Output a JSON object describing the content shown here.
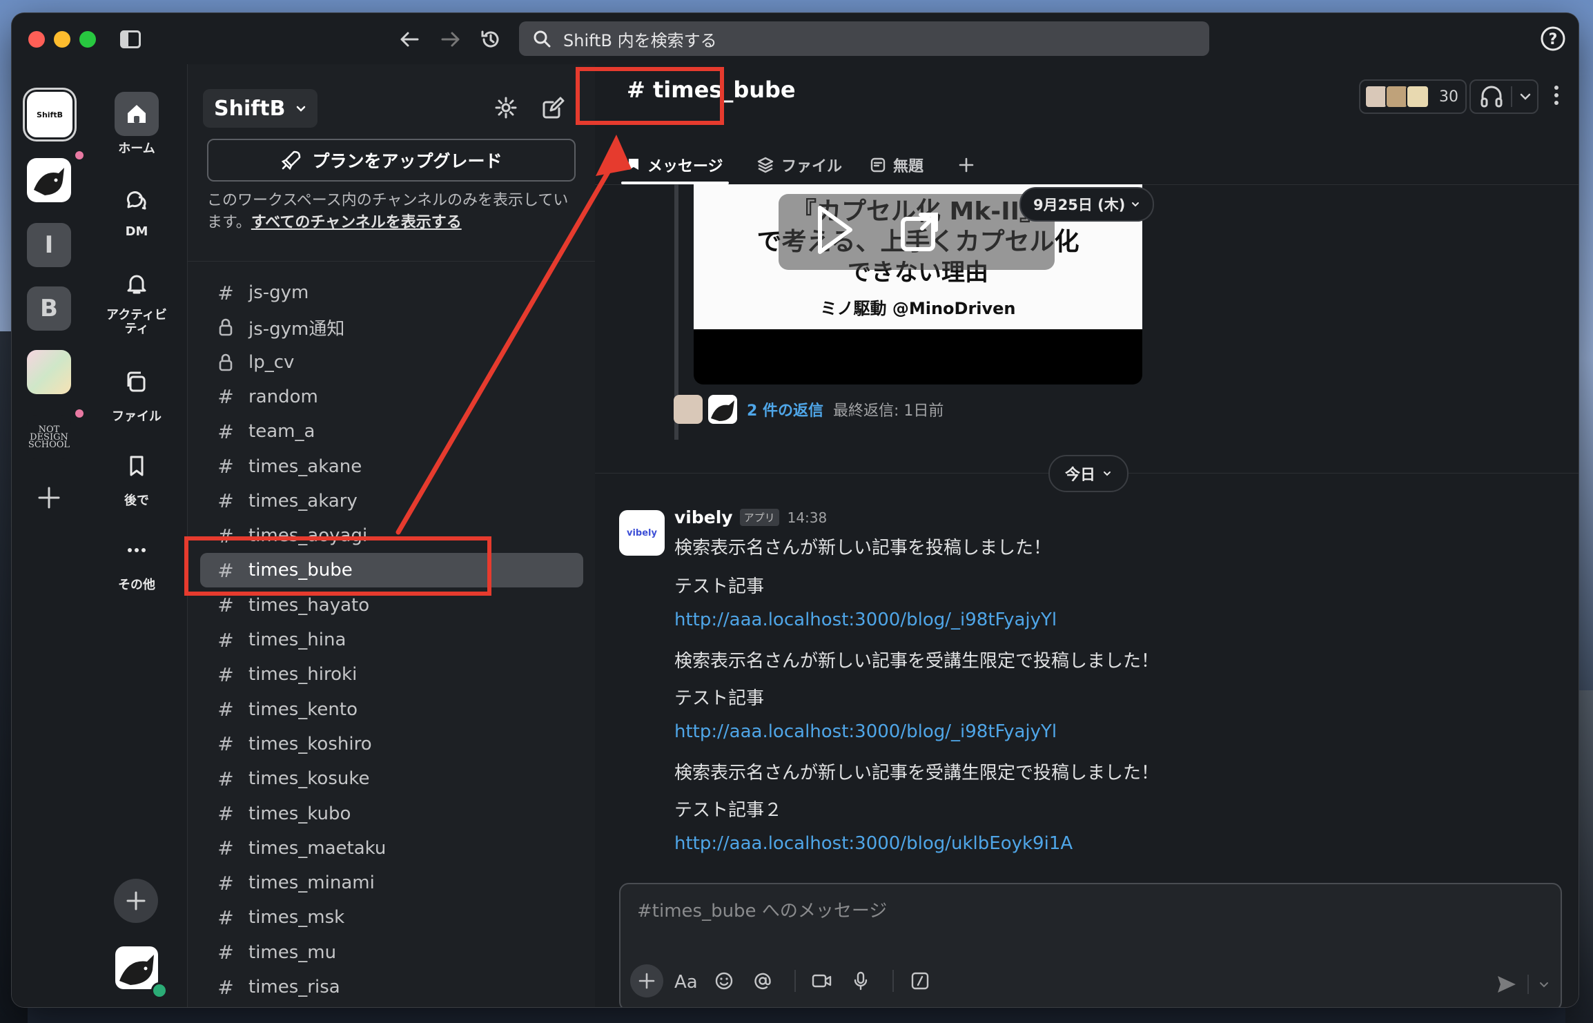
{
  "search": {
    "placeholder": "ShiftB 内を検索する"
  },
  "workspaces": [
    {
      "id": "shiftb",
      "label": "ShiftB"
    },
    {
      "id": "cat",
      "label": ""
    },
    {
      "id": "i",
      "label": "I"
    },
    {
      "id": "b",
      "label": "B"
    },
    {
      "id": "pic",
      "label": ""
    },
    {
      "id": "nds",
      "label": "NOT DESIGN SCHOOL"
    }
  ],
  "nav": {
    "home": "ホーム",
    "dm": "DM",
    "activity": "アクティビティ",
    "files": "ファイル",
    "later": "後で",
    "more": "その他"
  },
  "sidebar": {
    "workspace_name": "ShiftB",
    "upgrade_label": "プランをアップグレード",
    "note": "このワークスペース内のチャンネルのみを表示しています。",
    "note_link": "すべてのチャンネルを表示する",
    "channels": [
      {
        "name": "js-gym",
        "type": "public"
      },
      {
        "name": "js-gym通知",
        "type": "private"
      },
      {
        "name": "lp_cv",
        "type": "private"
      },
      {
        "name": "random",
        "type": "public"
      },
      {
        "name": "team_a",
        "type": "public"
      },
      {
        "name": "times_akane",
        "type": "public"
      },
      {
        "name": "times_akary",
        "type": "public"
      },
      {
        "name": "times_aoyagi",
        "type": "public"
      },
      {
        "name": "times_bube",
        "type": "public",
        "active": true
      },
      {
        "name": "times_hayato",
        "type": "public"
      },
      {
        "name": "times_hina",
        "type": "public"
      },
      {
        "name": "times_hiroki",
        "type": "public"
      },
      {
        "name": "times_kento",
        "type": "public"
      },
      {
        "name": "times_koshiro",
        "type": "public"
      },
      {
        "name": "times_kosuke",
        "type": "public"
      },
      {
        "name": "times_kubo",
        "type": "public"
      },
      {
        "name": "times_maetaku",
        "type": "public"
      },
      {
        "name": "times_minami",
        "type": "public"
      },
      {
        "name": "times_msk",
        "type": "public"
      },
      {
        "name": "times_mu",
        "type": "public"
      },
      {
        "name": "times_risa",
        "type": "public"
      }
    ]
  },
  "channel": {
    "title": "# times_bube",
    "member_count": "30",
    "tabs": [
      "メッセージ",
      "ファイル",
      "無題"
    ]
  },
  "thread": {
    "video_lines": [
      "『カプセル化 Mk-II』",
      "で考える、上手くカプセル化",
      "できない理由",
      "ミノ駆動 @MinoDriven"
    ],
    "date_pill": "9月25日 (木)",
    "reply_count": "2 件の返信",
    "last_reply": "最終返信: 1日前"
  },
  "today_label": "今日",
  "message": {
    "avatar_text": "vibely",
    "author": "vibely",
    "badge": "アプリ",
    "time": "14:38",
    "lines": [
      {
        "text": "検索表示名さんが新しい記事を投稿しました！",
        "link": false
      },
      {
        "text": "テスト記事",
        "link": false
      },
      {
        "text": "http://aaa.localhost:3000/blog/_i98tFyajyYl",
        "link": true
      },
      {
        "text": "検索表示名さんが新しい記事を受講生限定で投稿しました！",
        "link": false
      },
      {
        "text": "テスト記事",
        "link": false
      },
      {
        "text": "http://aaa.localhost:3000/blog/_i98tFyajyYl",
        "link": true
      },
      {
        "text": "検索表示名さんが新しい記事を受講生限定で投稿しました！",
        "link": false
      },
      {
        "text": "テスト記事２",
        "link": false
      },
      {
        "text": "http://aaa.localhost:3000/blog/uklbEoyk9i1A",
        "link": true
      }
    ]
  },
  "composer": {
    "placeholder": "#times_bube へのメッセージ"
  },
  "colors": {
    "annotation": "#e63b2e",
    "link": "#4fa6e8",
    "active_channel": "#4a4d52"
  }
}
